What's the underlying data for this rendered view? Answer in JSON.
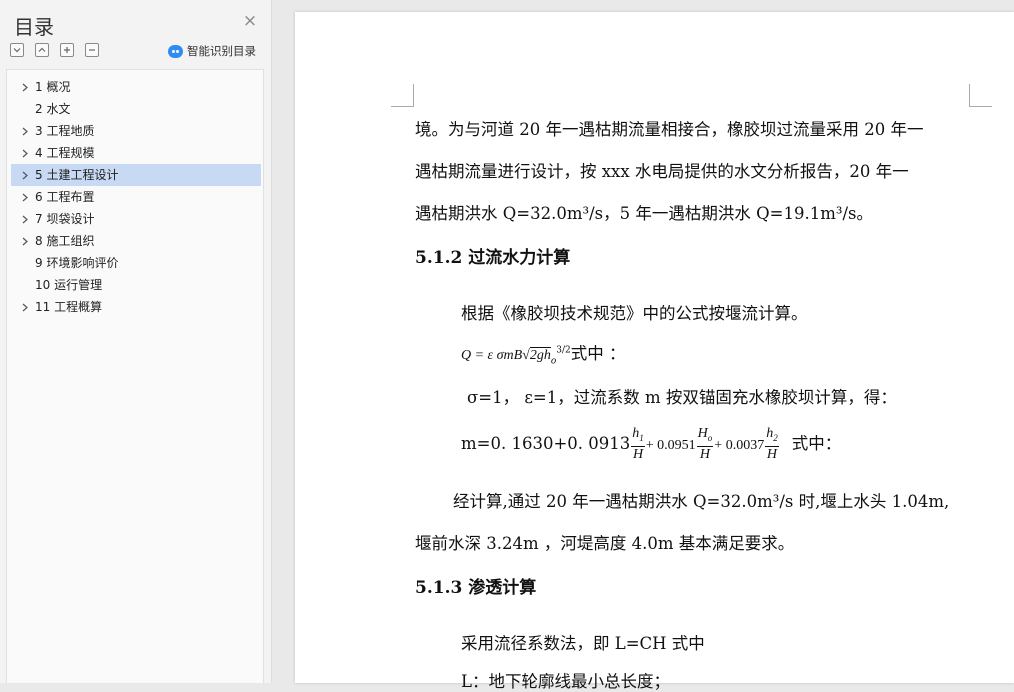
{
  "sidebar": {
    "title": "目录",
    "close_glyph": "×",
    "smart_label": "智能识别目录",
    "items": [
      {
        "label": "1 概况",
        "expandable": true,
        "active": false
      },
      {
        "label": "2 水文",
        "expandable": false,
        "active": false
      },
      {
        "label": "3 工程地质",
        "expandable": true,
        "active": false
      },
      {
        "label": "4  工程规模",
        "expandable": true,
        "active": false
      },
      {
        "label": "5 土建工程设计",
        "expandable": true,
        "active": true
      },
      {
        "label": "6 工程布置",
        "expandable": true,
        "active": false
      },
      {
        "label": "7  坝袋设计",
        "expandable": true,
        "active": false
      },
      {
        "label": "8 施工组织",
        "expandable": true,
        "active": false
      },
      {
        "label": "9 环境影响评价",
        "expandable": false,
        "active": false
      },
      {
        "label": "10  运行管理",
        "expandable": false,
        "active": false
      },
      {
        "label": "11 工程概算",
        "expandable": true,
        "active": false
      }
    ]
  },
  "document": {
    "para1_line1": "境。为与河道 20 年一遇枯期流量相接合，橡胶坝过流量采用 20 年一",
    "para1_line2": "遇枯期流量进行设计，按 xxx 水电局提供的水文分析报告，20 年一",
    "para1_line3": "遇枯期洪水 Q=32.0m³/s，5 年一遇枯期洪水 Q=19.1m³/s。",
    "heading_512": "5.1.2 过流水力计算",
    "para2": "根据《橡胶坝技术规范》中的公式按堰流计算。",
    "formula1_lhs": "Q = ε σmB",
    "formula1_sqrt": "2gh",
    "formula1_sub": "o",
    "formula1_exp": "3/2",
    "formula1_suffix": "式中 ：",
    "para3": "σ=1， ε=1，过流系数 m 按双锚固充水橡胶坝计算，得：",
    "formula2_prefix": "m=0. 1630+0. 0913",
    "formula2_c2": "+ 0.0951",
    "formula2_c3": "+ 0.0037",
    "formula2_f1_num": "h",
    "formula2_f1_sub": "1",
    "formula2_f2_num": "H",
    "formula2_f2_sub": "o",
    "formula2_f3_num": "h",
    "formula2_f3_sub": "2",
    "formula2_den": "H",
    "formula2_suffix": "式中：",
    "para4_line1": "经计算,通过 20 年一遇枯期洪水 Q=32.0m³/s 时,堰上水头 1.04m,",
    "para4_line2": "堰前水深 3.24m ，河堤高度 4.0m 基本满足要求。",
    "heading_513": "5.1.3 渗透计算",
    "para5": "采用流径系数法，即 L=CH 式中",
    "para6": "L：地下轮廓线最小总长度；"
  }
}
